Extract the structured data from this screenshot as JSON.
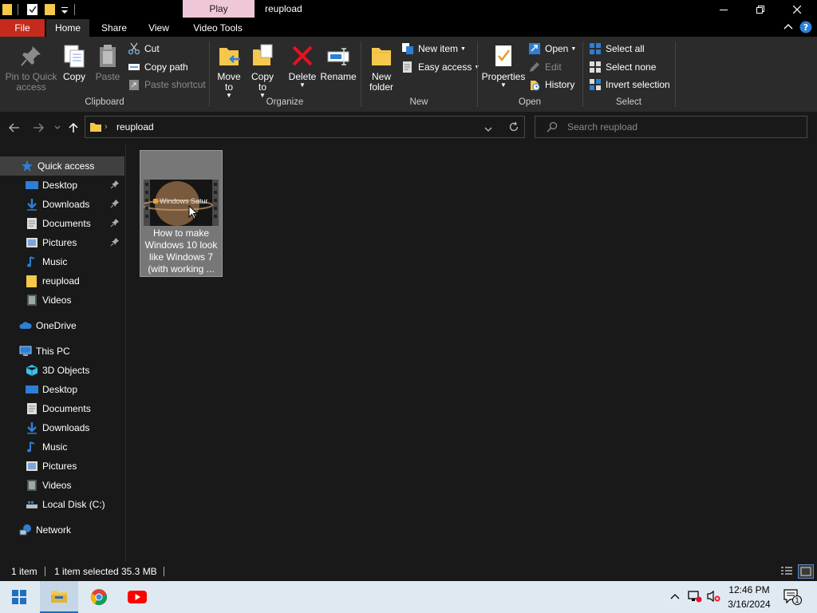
{
  "titlebar": {
    "contextual_tab": "Play",
    "window_title": "reupload"
  },
  "tabs": {
    "file": "File",
    "home": "Home",
    "share": "Share",
    "view": "View",
    "video_tools": "Video Tools"
  },
  "ribbon": {
    "clipboard": {
      "label": "Clipboard",
      "pin": "Pin to Quick access",
      "copy": "Copy",
      "paste": "Paste",
      "cut": "Cut",
      "copy_path": "Copy path",
      "paste_shortcut": "Paste shortcut"
    },
    "organize": {
      "label": "Organize",
      "move_to": "Move to",
      "copy_to": "Copy to",
      "delete": "Delete",
      "rename": "Rename"
    },
    "new": {
      "label": "New",
      "new_folder": "New folder",
      "new_item": "New item",
      "easy_access": "Easy access"
    },
    "open": {
      "label": "Open",
      "properties": "Properties",
      "open": "Open",
      "edit": "Edit",
      "history": "History"
    },
    "select": {
      "label": "Select",
      "select_all": "Select all",
      "select_none": "Select none",
      "invert": "Invert selection"
    }
  },
  "address": {
    "path": "reupload",
    "search_placeholder": "Search reupload"
  },
  "nav": {
    "quick_access": "Quick access",
    "quick_items": [
      "Desktop",
      "Downloads",
      "Documents",
      "Pictures",
      "Music",
      "reupload",
      "Videos"
    ],
    "onedrive": "OneDrive",
    "this_pc": "This PC",
    "pc_items": [
      "3D Objects",
      "Desktop",
      "Documents",
      "Downloads",
      "Music",
      "Pictures",
      "Videos",
      "Local Disk (C:)"
    ],
    "network": "Network"
  },
  "files": [
    {
      "name": "How to make Windows 10 look like Windows 7 (with working ...",
      "thumb_text": "Windows Satur"
    }
  ],
  "status": {
    "count": "1 item",
    "selected": "1 item selected",
    "size": "35.3 MB"
  },
  "taskbar": {
    "time": "12:46 PM",
    "date": "3/16/2024",
    "notification_count": "1"
  },
  "colors": {
    "file_tab": "#c42b1c",
    "play_tab": "#f0c6d9",
    "accent_blue": "#2d7fd3",
    "folder_yellow": "#f5c84c",
    "taskbar": "#dfe9f2"
  }
}
